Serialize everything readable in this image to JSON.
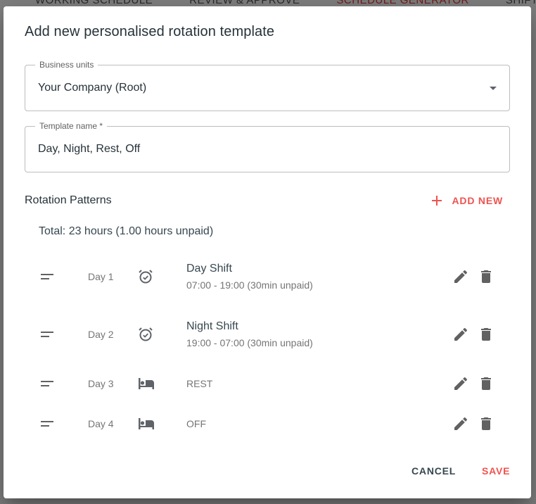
{
  "background": {
    "tabs": [
      "WORKING SCHEDULE",
      "REVIEW & APPROVE",
      "SCHEDULE GENERATOR",
      "SHIFT TEMPLA"
    ],
    "active_tab_index": 2
  },
  "dialog": {
    "title": "Add new personalised rotation template",
    "business_units": {
      "label": "Business units",
      "value": "Your Company (Root)"
    },
    "template_name": {
      "label": "Template name *",
      "value": "Day, Night, Rest, Off"
    },
    "section_title": "Rotation Patterns",
    "add_new_label": "ADD NEW",
    "total": "Total: 23 hours (1.00 hours unpaid)",
    "rows": [
      {
        "day": "Day 1",
        "icon": "alarm-icon",
        "name": "Day Shift",
        "time": "07:00 - 19:00 (30min unpaid)"
      },
      {
        "day": "Day 2",
        "icon": "alarm-icon",
        "name": "Night Shift",
        "time": "19:00 - 07:00 (30min unpaid)"
      },
      {
        "day": "Day 3",
        "icon": "bed-icon",
        "name": "REST"
      },
      {
        "day": "Day 4",
        "icon": "bed-icon",
        "name": "OFF"
      }
    ],
    "cancel_label": "CANCEL",
    "save_label": "SAVE"
  },
  "colors": {
    "accent": "#ef5350",
    "text_dark": "#263238",
    "text_muted": "#757575",
    "icon_grey": "#5f6368"
  }
}
